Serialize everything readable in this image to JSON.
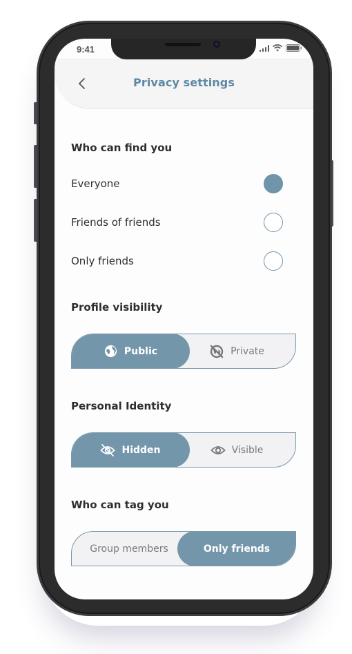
{
  "status_bar": {
    "time": "9:41"
  },
  "header": {
    "title": "Privacy settings",
    "back_icon": "chevron-left-icon"
  },
  "accent_color": "#7496ab",
  "find_you": {
    "title": "Who can find you",
    "options": [
      {
        "label": "Everyone",
        "selected": true
      },
      {
        "label": "Friends of friends",
        "selected": false
      },
      {
        "label": "Only friends",
        "selected": false
      }
    ]
  },
  "profile_visibility": {
    "title": "Profile visibility",
    "options": [
      {
        "label": "Public",
        "icon": "globe-icon",
        "selected": true
      },
      {
        "label": "Private",
        "icon": "globe-off-icon",
        "selected": false
      }
    ]
  },
  "personal_identity": {
    "title": "Personal Identity",
    "options": [
      {
        "label": "Hidden",
        "icon": "eye-off-icon",
        "selected": true
      },
      {
        "label": "Visible",
        "icon": "eye-icon",
        "selected": false
      }
    ]
  },
  "tag_you": {
    "title": "Who can tag you",
    "options": [
      {
        "label": "Group members",
        "selected": false
      },
      {
        "label": "Only friends",
        "selected": true
      }
    ]
  }
}
